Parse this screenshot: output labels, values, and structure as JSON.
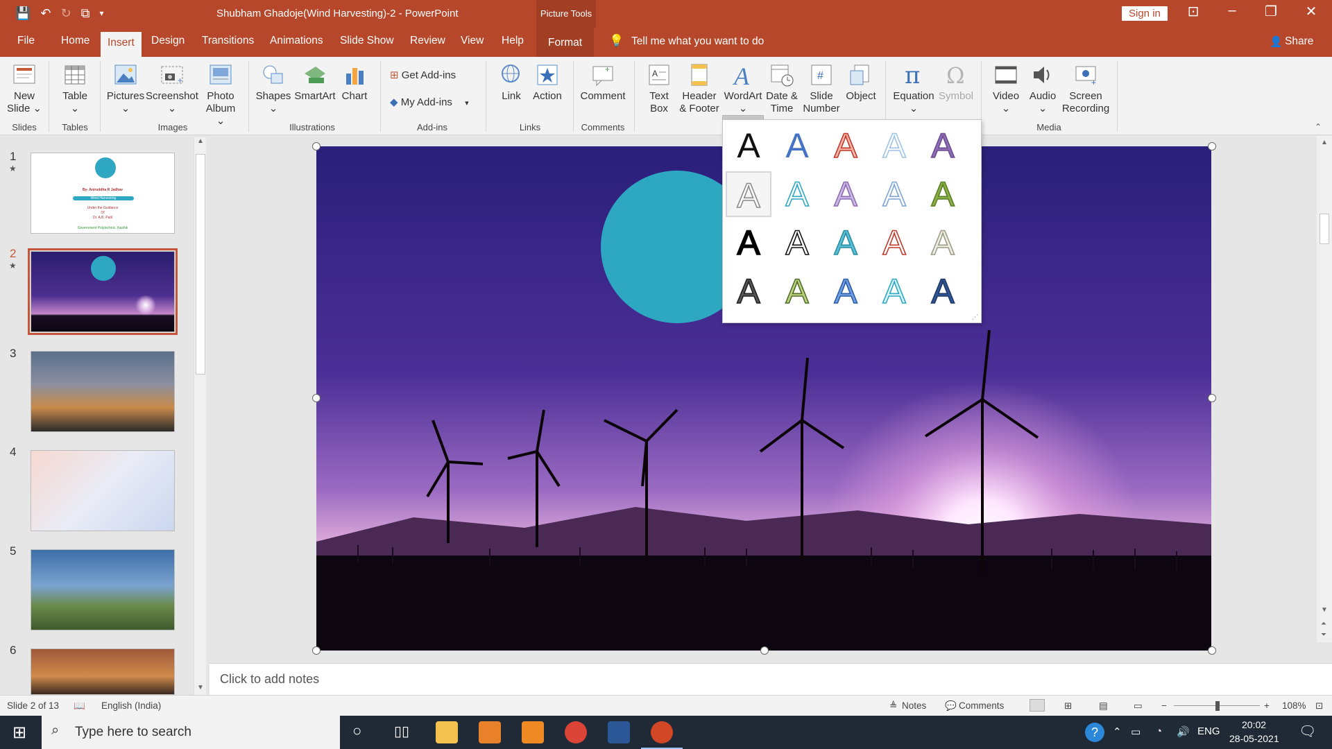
{
  "app": {
    "title": "Shubham Ghadoje(Wind Harvesting)-2  -  PowerPoint",
    "context_tab_header": "Picture Tools",
    "sign_in": "Sign in",
    "qat_icons": [
      "save-icon",
      "undo-icon",
      "redo-icon",
      "present-icon",
      "customize-icon"
    ]
  },
  "tabs": {
    "file": "File",
    "home": "Home",
    "insert": "Insert",
    "design": "Design",
    "transitions": "Transitions",
    "animations": "Animations",
    "slide_show": "Slide Show",
    "review": "Review",
    "view": "View",
    "help": "Help",
    "format": "Format",
    "tell_me": "Tell me what you want to do",
    "share": "Share"
  },
  "ribbon": {
    "new_slide": [
      "New",
      "Slide ⌄"
    ],
    "table": [
      "Table",
      "⌄"
    ],
    "pictures": [
      "Pictures",
      "⌄"
    ],
    "screenshot": [
      "Screenshot",
      "⌄"
    ],
    "photo_album": [
      "Photo",
      "Album ⌄"
    ],
    "shapes": [
      "Shapes",
      "⌄"
    ],
    "smartart": "SmartArt",
    "chart": "Chart",
    "get_addins": "Get Add-ins",
    "my_addins": "My Add-ins",
    "link": "Link",
    "action": "Action",
    "comment": "Comment",
    "text_box": [
      "Text",
      "Box"
    ],
    "header_footer": [
      "Header",
      "& Footer"
    ],
    "wordart": [
      "WordArt",
      "⌄"
    ],
    "date_time": [
      "Date &",
      "Time"
    ],
    "slide_number": [
      "Slide",
      "Number"
    ],
    "object": "Object",
    "equation": [
      "Equation",
      "⌄"
    ],
    "symbol": "Symbol",
    "video": [
      "Video",
      "⌄"
    ],
    "audio": [
      "Audio",
      "⌄"
    ],
    "screen_recording": [
      "Screen",
      "Recording"
    ],
    "groups": {
      "slides": "Slides",
      "tables": "Tables",
      "images": "Images",
      "illustrations": "Illustrations",
      "addins": "Add-ins",
      "links": "Links",
      "comments": "Comments",
      "media": "Media"
    }
  },
  "wordart_gallery": {
    "glyph": "A",
    "styles": [
      {
        "fill": "#111111",
        "stroke": "none"
      },
      {
        "fill": "#4472c4",
        "stroke": "none"
      },
      {
        "fill": "#f4b6a9",
        "stroke": "#c0392b"
      },
      {
        "fill": "#ffffff",
        "stroke": "#9dc3e6"
      },
      {
        "fill": "#8e6db4",
        "stroke": "#6b4d93"
      },
      {
        "fill": "#ffffff",
        "stroke": "#8a8a8a"
      },
      {
        "fill": "#ffffff",
        "stroke": "#2ea8c2"
      },
      {
        "fill": "#c9b8e4",
        "stroke": "#8e6db4"
      },
      {
        "fill": "#ffffff",
        "stroke": "#7da4d6"
      },
      {
        "fill": "#8bb04a",
        "stroke": "#5a7d22"
      },
      {
        "fill": "#000000",
        "stroke": "#000000"
      },
      {
        "fill": "#ffffff",
        "stroke": "#111111"
      },
      {
        "fill": "#5bc0d6",
        "stroke": "#2a8fa6"
      },
      {
        "fill": "#ffffff",
        "stroke": "#c0392b"
      },
      {
        "fill": "#f0efe6",
        "stroke": "#9e9b85"
      },
      {
        "fill": "#555555",
        "stroke": "#222222"
      },
      {
        "fill": "#b8d37a",
        "stroke": "#556b2f"
      },
      {
        "fill": "#6f9ee0",
        "stroke": "#2e5ea8"
      },
      {
        "fill": "#d9f3f8",
        "stroke": "#2ea8c2"
      },
      {
        "fill": "#2f5597",
        "stroke": "#1f3864"
      }
    ]
  },
  "slides_panel": {
    "numbers": [
      "1",
      "2",
      "3",
      "4",
      "5",
      "6"
    ],
    "selected": 2,
    "thumb1_lines": [
      "By- Aniruddha R Jadhav",
      "Wind Harvesting",
      "Under the Guidance",
      "Of",
      "Dr. A.B. Patil",
      "Government Polytechnic, Nashik"
    ]
  },
  "notes_placeholder": "Click to add notes",
  "status": {
    "slide_of": "Slide 2 of 13",
    "language": "English (India)",
    "notes": "Notes",
    "comments": "Comments",
    "zoom": "108%"
  },
  "taskbar": {
    "search_placeholder": "Type here to search",
    "lang": "ENG",
    "time": "20:02",
    "date": "28-05-2021"
  },
  "colors": {
    "accent": "#b7472a",
    "ribbon_bg": "#f3f3f3",
    "taskbar": "#1f2a36"
  }
}
